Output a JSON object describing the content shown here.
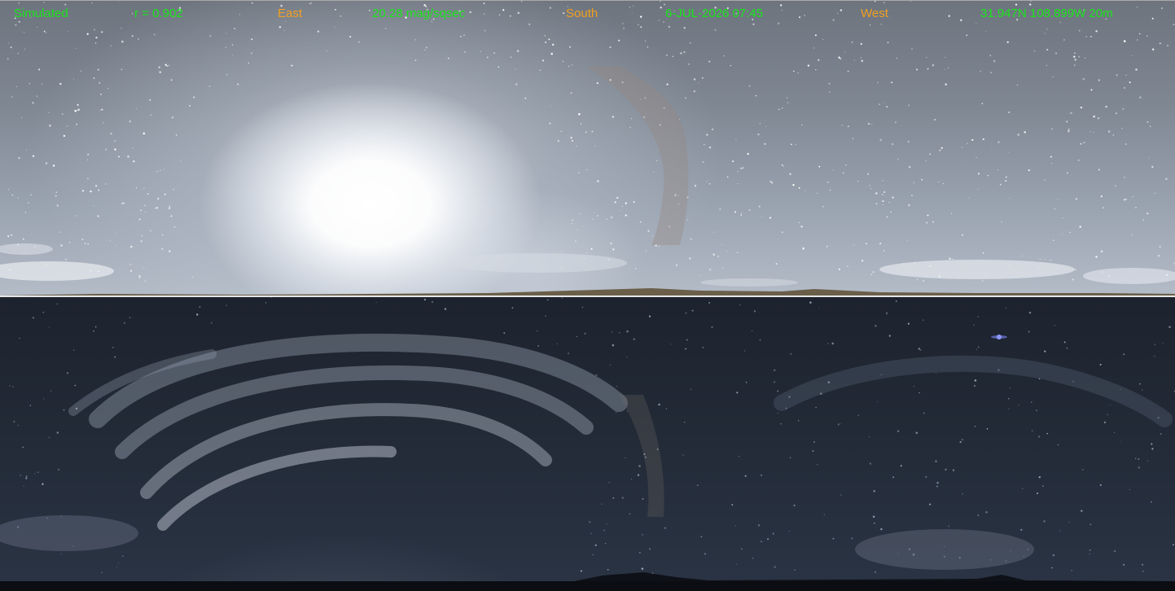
{
  "header": {
    "mode": "Simulated",
    "correlation": "r = 0.902",
    "brightness": "20.28 mag/sqsec",
    "datetime": "6-JUL-2026 07:45",
    "location": "31.947N 108.899W 20m"
  },
  "directions": {
    "east": "East",
    "south": "South",
    "west": "West"
  },
  "colors": {
    "info_text": "#19e619",
    "direction_text": "#f0a020",
    "divider": "#e6e6e6"
  }
}
